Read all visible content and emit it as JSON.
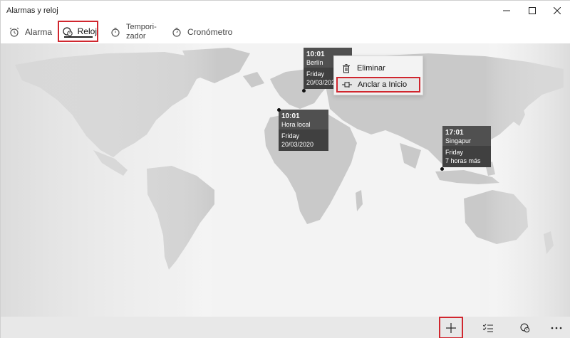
{
  "window": {
    "title": "Alarmas y reloj"
  },
  "tabs": [
    {
      "label": "Alarma",
      "icon": "alarm-clock-icon"
    },
    {
      "label": "Reloj",
      "icon": "world-clock-icon"
    },
    {
      "label": "Tempori- zador",
      "icon": "timer-icon"
    },
    {
      "label": "Cronómetro",
      "icon": "stopwatch-icon"
    }
  ],
  "clocks": {
    "berlin": {
      "time": "10:01",
      "city": "Berlín",
      "day": "Friday",
      "date": "20/03/2020"
    },
    "local": {
      "time": "10:01",
      "city": "Hora local",
      "day": "Friday",
      "date": "20/03/2020"
    },
    "singapore": {
      "time": "17:01",
      "city": "Singapur",
      "day": "Friday",
      "diff": "7 horas más"
    }
  },
  "context_menu": {
    "delete_label": "Eliminar",
    "pin_label": "Anclar a Inicio"
  },
  "colors": {
    "highlight": "#d0262e",
    "card_bg": "#505050",
    "map_land": "#c8c8c8"
  }
}
